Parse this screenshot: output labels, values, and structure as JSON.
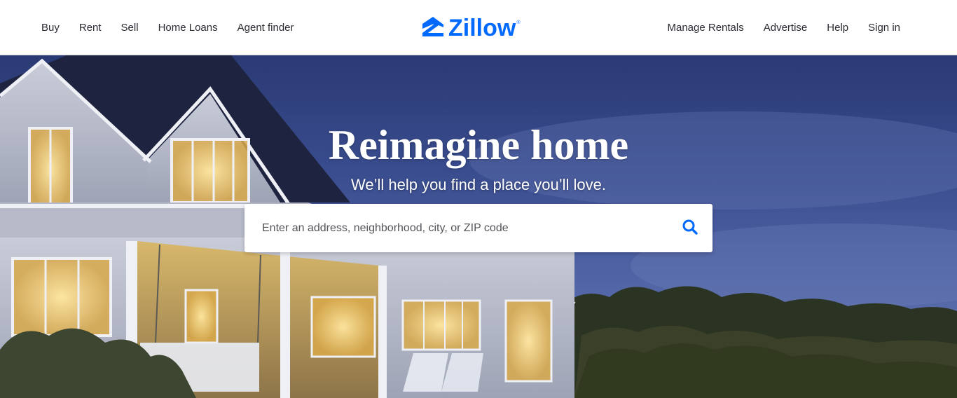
{
  "header": {
    "nav_left": [
      {
        "label": "Buy"
      },
      {
        "label": "Rent"
      },
      {
        "label": "Sell"
      },
      {
        "label": "Home Loans"
      },
      {
        "label": "Agent finder"
      }
    ],
    "logo": {
      "text": "Zillow",
      "registered_mark": "®",
      "icon": "zillow-house-icon"
    },
    "nav_right": [
      {
        "label": "Manage Rentals"
      },
      {
        "label": "Advertise"
      },
      {
        "label": "Help"
      },
      {
        "label": "Sign in"
      }
    ]
  },
  "hero": {
    "title": "Reimagine home",
    "subtitle": "We’ll help you find a place you’ll love.",
    "search": {
      "placeholder": "Enter an address, neighborhood, city, or ZIP code",
      "value": "",
      "button_icon": "search-icon"
    }
  },
  "colors": {
    "brand": "#006aff",
    "nav_text": "#2a2a33",
    "sky": "#3a4d8f"
  }
}
